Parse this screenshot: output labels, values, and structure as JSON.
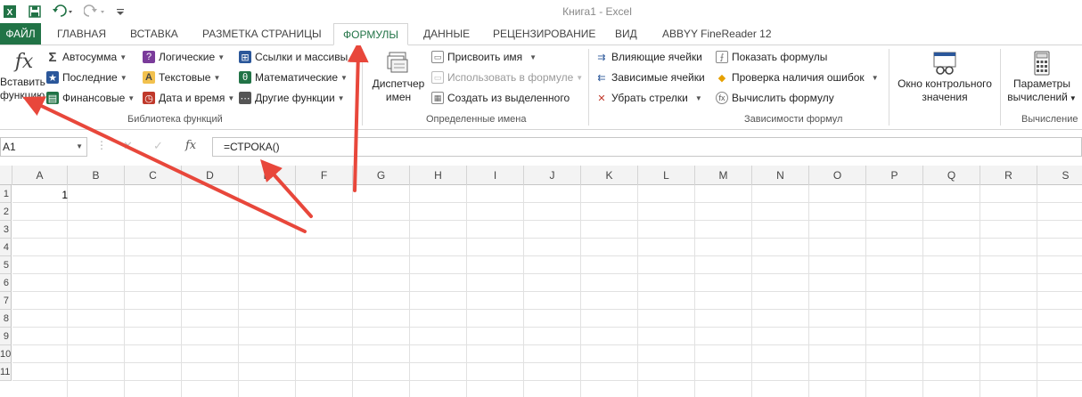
{
  "titlebar": {
    "title": "Книга1 - Excel"
  },
  "tabs": {
    "file": "ФАЙЛ",
    "home": "ГЛАВНАЯ",
    "insert": "ВСТАВКА",
    "page_layout": "РАЗМЕТКА СТРАНИЦЫ",
    "formulas": "ФОРМУЛЫ",
    "data": "ДАННЫЕ",
    "review": "РЕЦЕНЗИРОВАНИЕ",
    "view": "ВИД",
    "abbyy": "ABBYY FineReader 12"
  },
  "ribbon": {
    "insert_function": {
      "line1": "Вставить",
      "line2": "функцию"
    },
    "library": {
      "autosum": "Автосумма",
      "recent": "Последние",
      "financial": "Финансовые",
      "logical": "Логические",
      "text": "Текстовые",
      "datetime": "Дата и время",
      "lookup": "Ссылки и массивы",
      "math": "Математические",
      "other": "Другие функции",
      "label": "Библиотека функций"
    },
    "names": {
      "manager_line1": "Диспетчер",
      "manager_line2": "имен",
      "define": "Присвоить имя",
      "use_in_formula": "Использовать в формуле",
      "create": "Создать из выделенного",
      "label": "Определенные имена"
    },
    "audit": {
      "precedents": "Влияющие ячейки",
      "dependents": "Зависимые ячейки",
      "remove_arrows": "Убрать стрелки",
      "show_formulas": "Показать формулы",
      "error_check": "Проверка наличия ошибок",
      "evaluate": "Вычислить формулу",
      "label": "Зависимости формул"
    },
    "watch": {
      "line1": "Окно контрольного",
      "line2": "значения"
    },
    "calc": {
      "options_line1": "Параметры",
      "options_line2": "вычислений",
      "label": "Вычисление"
    }
  },
  "formula_bar": {
    "name_box": "A1",
    "fx": "fx",
    "formula": "=СТРОКА()"
  },
  "sheet": {
    "columns": [
      "A",
      "B",
      "C",
      "D",
      "E",
      "F",
      "G",
      "H",
      "I",
      "J",
      "K",
      "L",
      "M",
      "N",
      "O",
      "P",
      "Q",
      "R",
      "S"
    ],
    "rows": [
      "1",
      "2",
      "3",
      "4",
      "5",
      "6",
      "7",
      "8",
      "9",
      "10",
      "11"
    ],
    "a1_value": "1"
  },
  "colors": {
    "excel_green": "#217346",
    "arrow_red": "#e8473b"
  }
}
